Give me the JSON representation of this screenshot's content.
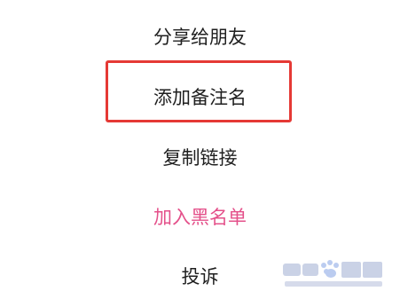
{
  "menu": {
    "items": [
      {
        "label": "分享给朋友"
      },
      {
        "label": "添加备注名"
      },
      {
        "label": "复制链接"
      },
      {
        "label": "加入黑名单"
      },
      {
        "label": "投诉"
      }
    ]
  },
  "colors": {
    "text": "#1f1f1f",
    "danger_text": "#e4508a",
    "highlight_border": "#e53935"
  },
  "watermark": {
    "brand": "Baidu 经验",
    "url": "jingyan.baidu.com"
  }
}
